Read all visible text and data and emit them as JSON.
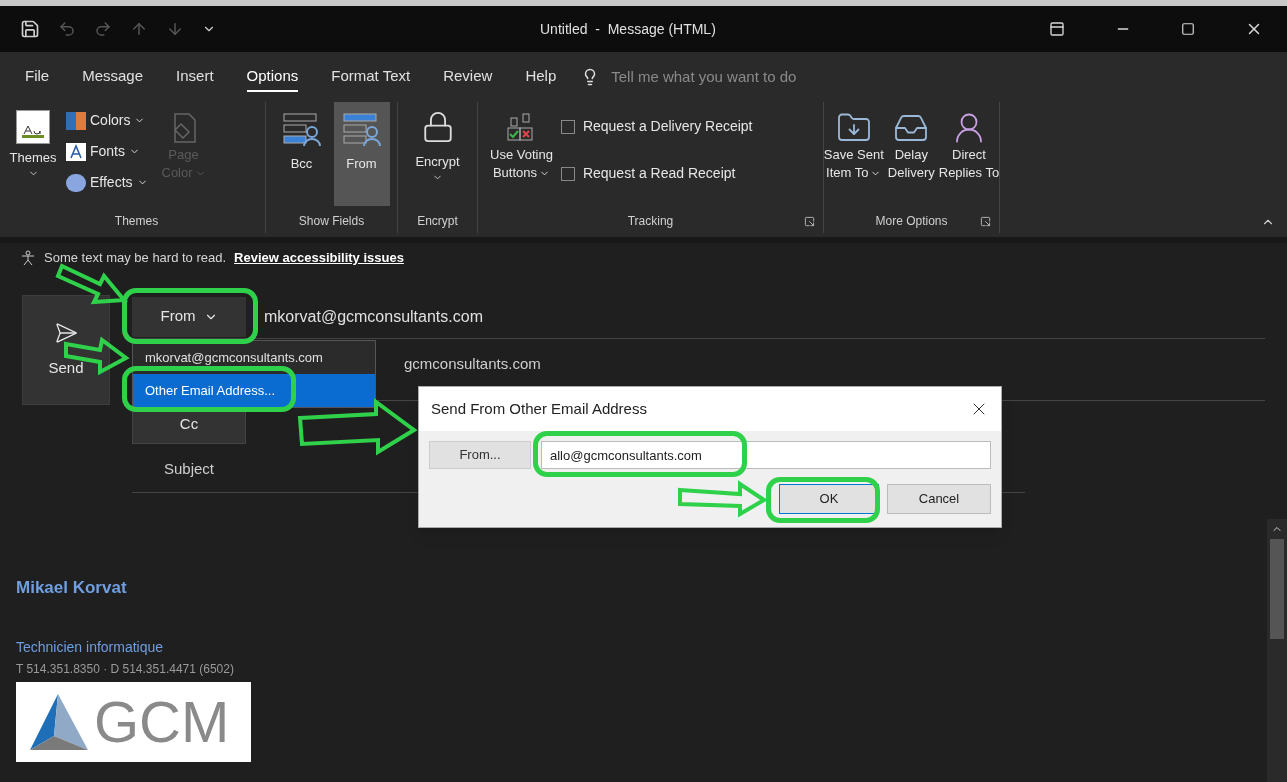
{
  "title_bar": {
    "title": "Untitled  -  Message (HTML)"
  },
  "menu_tabs": [
    {
      "label": "File",
      "selected": false
    },
    {
      "label": "Message",
      "selected": false
    },
    {
      "label": "Insert",
      "selected": false
    },
    {
      "label": "Options",
      "selected": true
    },
    {
      "label": "Format Text",
      "selected": false
    },
    {
      "label": "Review",
      "selected": false
    },
    {
      "label": "Help",
      "selected": false
    }
  ],
  "tell_me": {
    "placeholder": "Tell me what you want to do"
  },
  "ribbon": {
    "themes": {
      "label": "Themes",
      "big": {
        "label": "Themes"
      },
      "colors": {
        "label": "Colors"
      },
      "fonts": {
        "label": "Fonts"
      },
      "effects": {
        "label": "Effects"
      },
      "page_color": {
        "lines": [
          "Page",
          "Color"
        ],
        "disabled": true
      }
    },
    "show_fields": {
      "label": "Show Fields",
      "buttons": [
        {
          "label": "Bcc",
          "selected": false
        },
        {
          "label": "From",
          "selected": true
        }
      ]
    },
    "encrypt": {
      "label": "Encrypt",
      "button": {
        "label": "Encrypt"
      }
    },
    "tracking": {
      "label": "Tracking",
      "voting": {
        "lines": [
          "Use Voting",
          "Buttons"
        ]
      },
      "checkboxes": [
        {
          "label": "Request a Delivery Receipt",
          "checked": false
        },
        {
          "label": "Request a Read Receipt",
          "checked": false
        }
      ]
    },
    "more_options": {
      "label": "More Options",
      "save_sent": {
        "lines": [
          "Save Sent",
          "Item To"
        ]
      },
      "delay": {
        "lines": [
          "Delay",
          "Delivery"
        ]
      },
      "direct_replies": {
        "lines": [
          "Direct",
          "Replies To"
        ]
      }
    }
  },
  "info_bar": {
    "text": "Some text may be hard to read.",
    "link": "Review accessibility issues"
  },
  "compose": {
    "send": "Send",
    "from_button": "From",
    "from_address": "mkorvat@gcmconsultants.com",
    "to_address": "gcmconsultants.com",
    "cc_button": "Cc",
    "subject_label": "Subject"
  },
  "from_menu": {
    "options": [
      {
        "label": "mkorvat@gcmconsultants.com",
        "selected": false
      },
      {
        "label": "Other Email Address...",
        "selected": true
      }
    ]
  },
  "dialog": {
    "title": "Send From Other Email Address",
    "from_button": "From...",
    "address": "allo@gcmconsultants.com",
    "ok": "OK",
    "cancel": "Cancel"
  },
  "signature": {
    "name": "Mikael Korvat",
    "role": "Technicien informatique",
    "phone": "T 514.351.8350 · D 514.351.4471 (6502)",
    "logo": "GCM"
  }
}
